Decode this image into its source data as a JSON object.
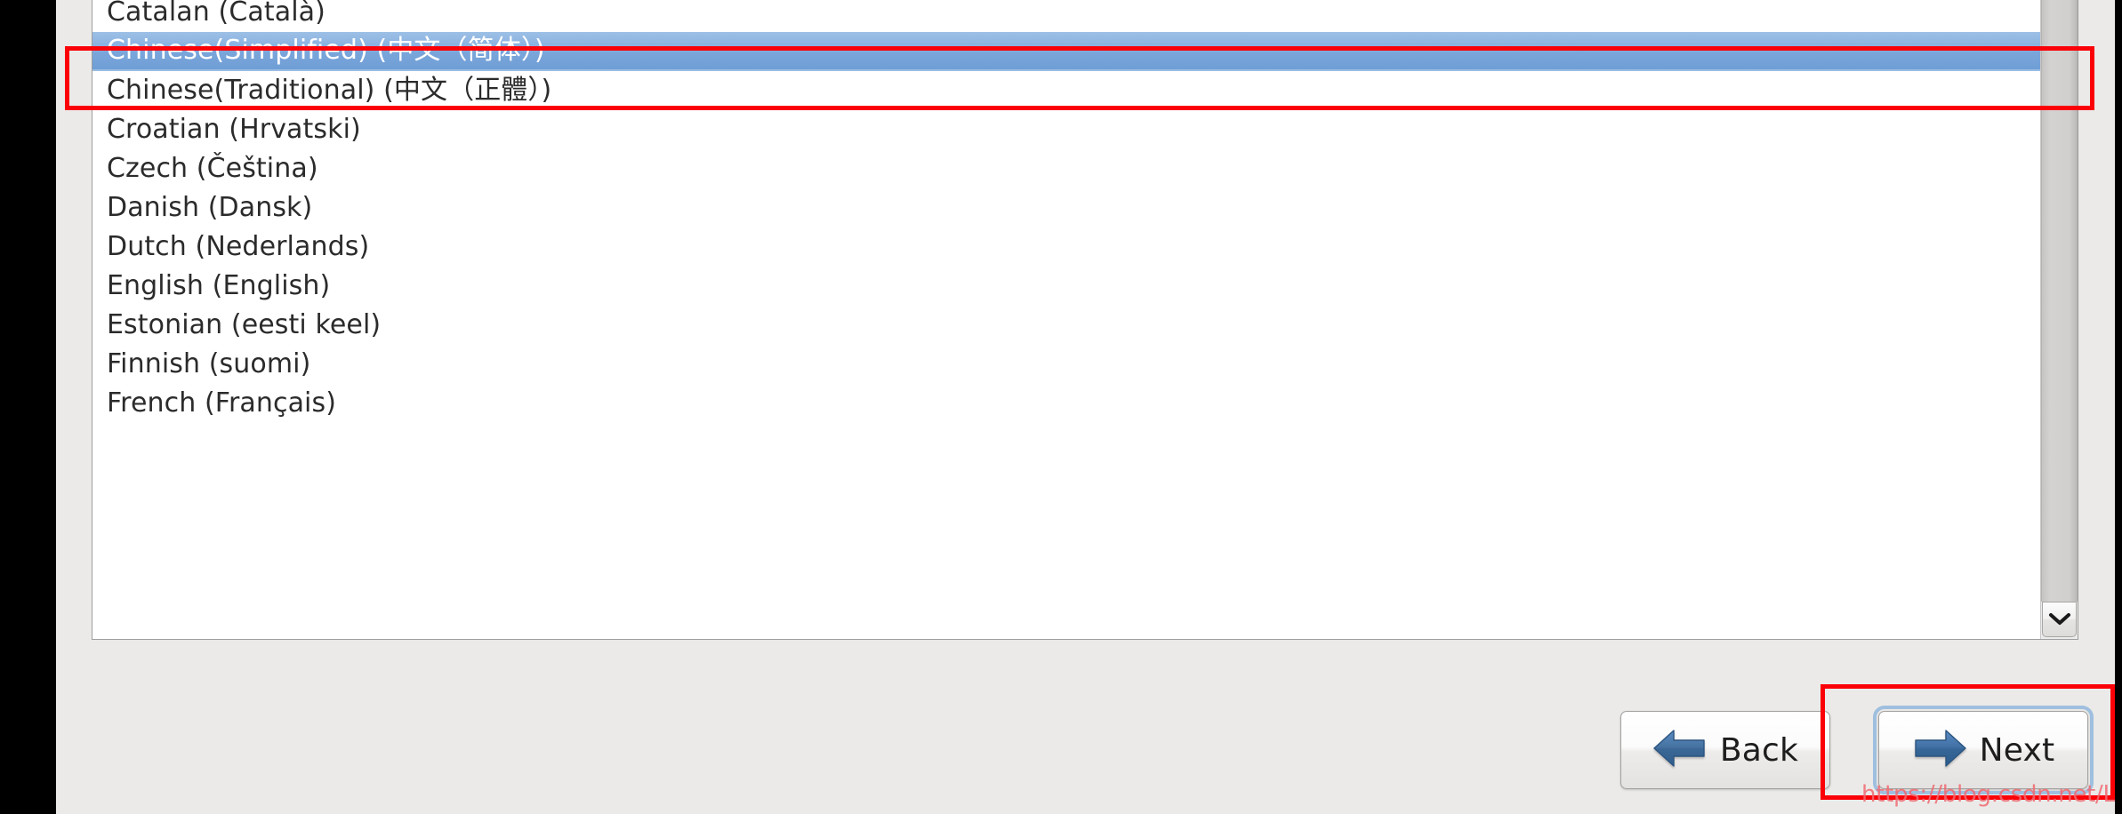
{
  "window": {
    "kind": "installer-language-selection-dialog",
    "background_color": "#ebeae8",
    "letterbox_color": "#000000"
  },
  "language_list": {
    "selected_index": 1,
    "selection_bg_color": "#82abdd",
    "selection_text_color": "#ffffff",
    "items": [
      {
        "label": "Catalan (Català)",
        "selected": false
      },
      {
        "label": "Chinese(Simplified) (中文（简体）)",
        "selected": true
      },
      {
        "label": "Chinese(Traditional) (中文（正體）)",
        "selected": false
      },
      {
        "label": "Croatian (Hrvatski)",
        "selected": false
      },
      {
        "label": "Czech (Čeština)",
        "selected": false
      },
      {
        "label": "Danish (Dansk)",
        "selected": false
      },
      {
        "label": "Dutch (Nederlands)",
        "selected": false
      },
      {
        "label": "English (English)",
        "selected": false
      },
      {
        "label": "Estonian (eesti keel)",
        "selected": false
      },
      {
        "label": "Finnish (suomi)",
        "selected": false
      },
      {
        "label": "French (Français)",
        "selected": false
      }
    ]
  },
  "scrollbar": {
    "orientation": "vertical",
    "down_arrow_icon": "chevron-down-icon",
    "track_color": "#d2d0ce"
  },
  "footer": {
    "back": {
      "label": "Back",
      "icon": "arrow-left-icon",
      "arrow_color": "#3a6ea5"
    },
    "next": {
      "label": "Next",
      "icon": "arrow-right-icon",
      "arrow_color": "#2f6bb0",
      "focused": true
    }
  },
  "annotations": {
    "highlight_color": "#fb0007",
    "boxes": [
      {
        "name": "selected-language-row",
        "target": "Chinese(Simplified) (中文（简体）)"
      },
      {
        "name": "next-button",
        "target": "Next"
      }
    ]
  },
  "watermark": {
    "text": "https://blog.csdn.net/L_iReign",
    "color": "#f06a72"
  }
}
